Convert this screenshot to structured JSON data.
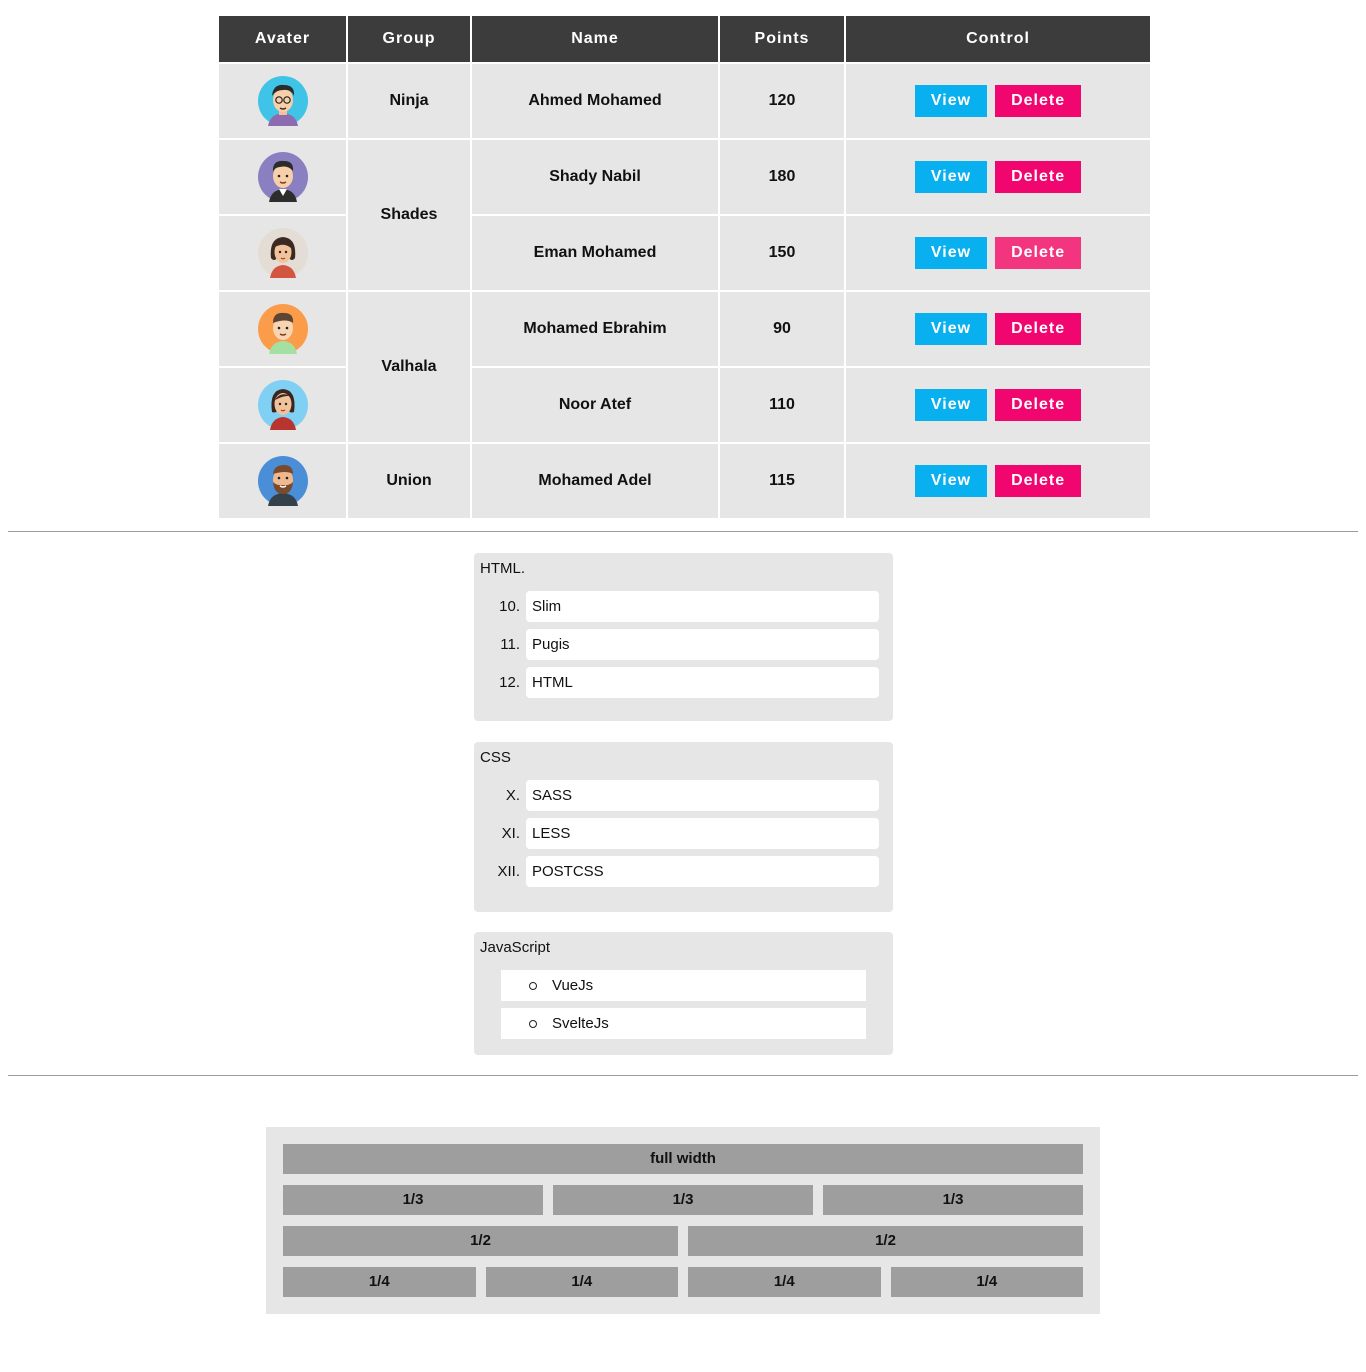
{
  "table": {
    "headers": [
      "Avater",
      "Group",
      "Name",
      "Points",
      "Control"
    ],
    "groups": [
      "Ninja",
      "Shades",
      "Valhala",
      "Union"
    ],
    "rows": [
      {
        "name": "Ahmed Mohamed",
        "points": "120"
      },
      {
        "name": "Shady Nabil",
        "points": "180"
      },
      {
        "name": "Eman Mohamed",
        "points": "150"
      },
      {
        "name": "Mohamed Ebrahim",
        "points": "90"
      },
      {
        "name": "Noor Atef",
        "points": "110"
      },
      {
        "name": "Mohamed Adel",
        "points": "115"
      }
    ],
    "view_label": "View",
    "delete_label": "Delete"
  },
  "lists": {
    "html": {
      "title": "HTML.",
      "items": [
        {
          "num": "10.",
          "text": "Slim"
        },
        {
          "num": "11.",
          "text": "Pugis"
        },
        {
          "num": "12.",
          "text": "HTML"
        }
      ]
    },
    "css": {
      "title": "CSS",
      "items": [
        {
          "num": "X.",
          "text": "SASS"
        },
        {
          "num": "XI.",
          "text": "LESS"
        },
        {
          "num": "XII.",
          "text": "POSTCSS"
        }
      ]
    },
    "js": {
      "title": "JavaScript",
      "items": [
        "VueJs",
        "SvelteJs"
      ]
    }
  },
  "grid": {
    "full": "full width",
    "third": "1/3",
    "half": "1/2",
    "quarter": "1/4"
  },
  "colors": {
    "header_bg": "#3c3c3c",
    "cell_bg": "#e6e6e6",
    "view": "#08b0ef",
    "delete": "#f0066e",
    "grid_cell": "#9e9e9e"
  },
  "icons": [
    "avatar-glasses-man",
    "avatar-purple-man",
    "avatar-woman",
    "avatar-orange-man",
    "avatar-blue-woman",
    "avatar-bearded-man"
  ]
}
